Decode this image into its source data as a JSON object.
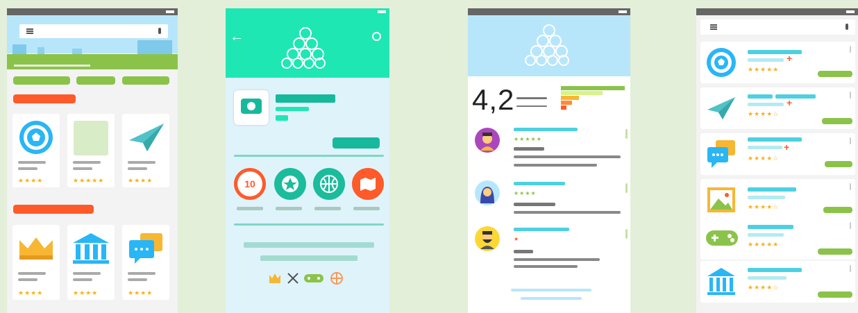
{
  "colors": {
    "green": "#8bc34a",
    "orange": "#ff5a2a",
    "teal": "#1ee7b4",
    "teal_dark": "#17b99c",
    "cyan": "#4dd0e1",
    "light_blue": "#b7e6fb",
    "star": "#f5b21e",
    "gray": "#9e9e9e"
  },
  "screen1": {
    "top_cards": [
      {
        "icon": "soccer-ball-icon",
        "stars": "★★★★"
      },
      {
        "icon": "image-placeholder",
        "stars": "★★★★★"
      },
      {
        "icon": "paper-plane-icon",
        "stars": "★★★★"
      }
    ],
    "bottom_cards": [
      {
        "icon": "crown-icon",
        "stars": "★★★★"
      },
      {
        "icon": "bank-icon",
        "stars": "★★★★"
      },
      {
        "icon": "chat-bubbles-icon",
        "stars": "★★★★"
      }
    ]
  },
  "screen2": {
    "badges": [
      {
        "icon": "ten-badge-icon",
        "text": "10"
      },
      {
        "icon": "star-badge-icon"
      },
      {
        "icon": "basketball-badge-icon"
      },
      {
        "icon": "map-badge-icon"
      }
    ],
    "footer_icons": [
      "crown-icon",
      "crossed-swords-icon",
      "gamepad-icon",
      "basketball-icon"
    ]
  },
  "screen3": {
    "rating": "4,2",
    "reviews": [
      {
        "avatar": "avatar-man-icon",
        "stars": "★★★★★"
      },
      {
        "avatar": "avatar-woman-icon",
        "stars": "★★★★"
      },
      {
        "avatar": "avatar-bearded-man-icon",
        "stars": "★"
      }
    ]
  },
  "screen4": {
    "items": [
      {
        "icon": "soccer-ball-icon",
        "stars": "★★★★★",
        "plus": "+"
      },
      {
        "icon": "paper-plane-icon",
        "stars": "★★★★☆",
        "plus": "+"
      },
      {
        "icon": "chat-bubbles-icon",
        "stars": "★★★★☆",
        "plus": "+"
      },
      {
        "icon": "photo-frame-icon",
        "stars": "★★★★☆",
        "plus": ""
      },
      {
        "icon": "gamepad-icon",
        "stars": "★★★★★",
        "plus": ""
      },
      {
        "icon": "bank-icon",
        "stars": "★★★★☆",
        "plus": ""
      }
    ]
  }
}
